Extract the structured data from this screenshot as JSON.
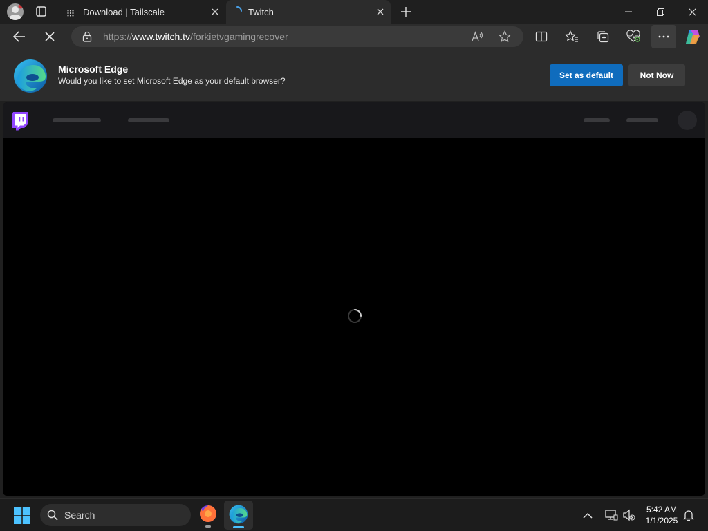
{
  "browser": {
    "tabs": [
      {
        "label": "Download | Tailscale",
        "active": false
      },
      {
        "label": "Twitch",
        "active": true
      }
    ],
    "url": {
      "prefix": "https://",
      "host": "www.twitch.tv",
      "path": "/forkietvgamingrecover"
    }
  },
  "infobar": {
    "title": "Microsoft Edge",
    "message": "Would you like to set Microsoft Edge as your default browser?",
    "primary_label": "Set as default",
    "secondary_label": "Not Now"
  },
  "taskbar": {
    "search_label": "Search",
    "time": "5:42 AM",
    "date": "1/1/2025"
  },
  "colors": {
    "accent": "#0f6cbd",
    "twitch_purple": "#9146ff",
    "page_bg": "#000000"
  }
}
